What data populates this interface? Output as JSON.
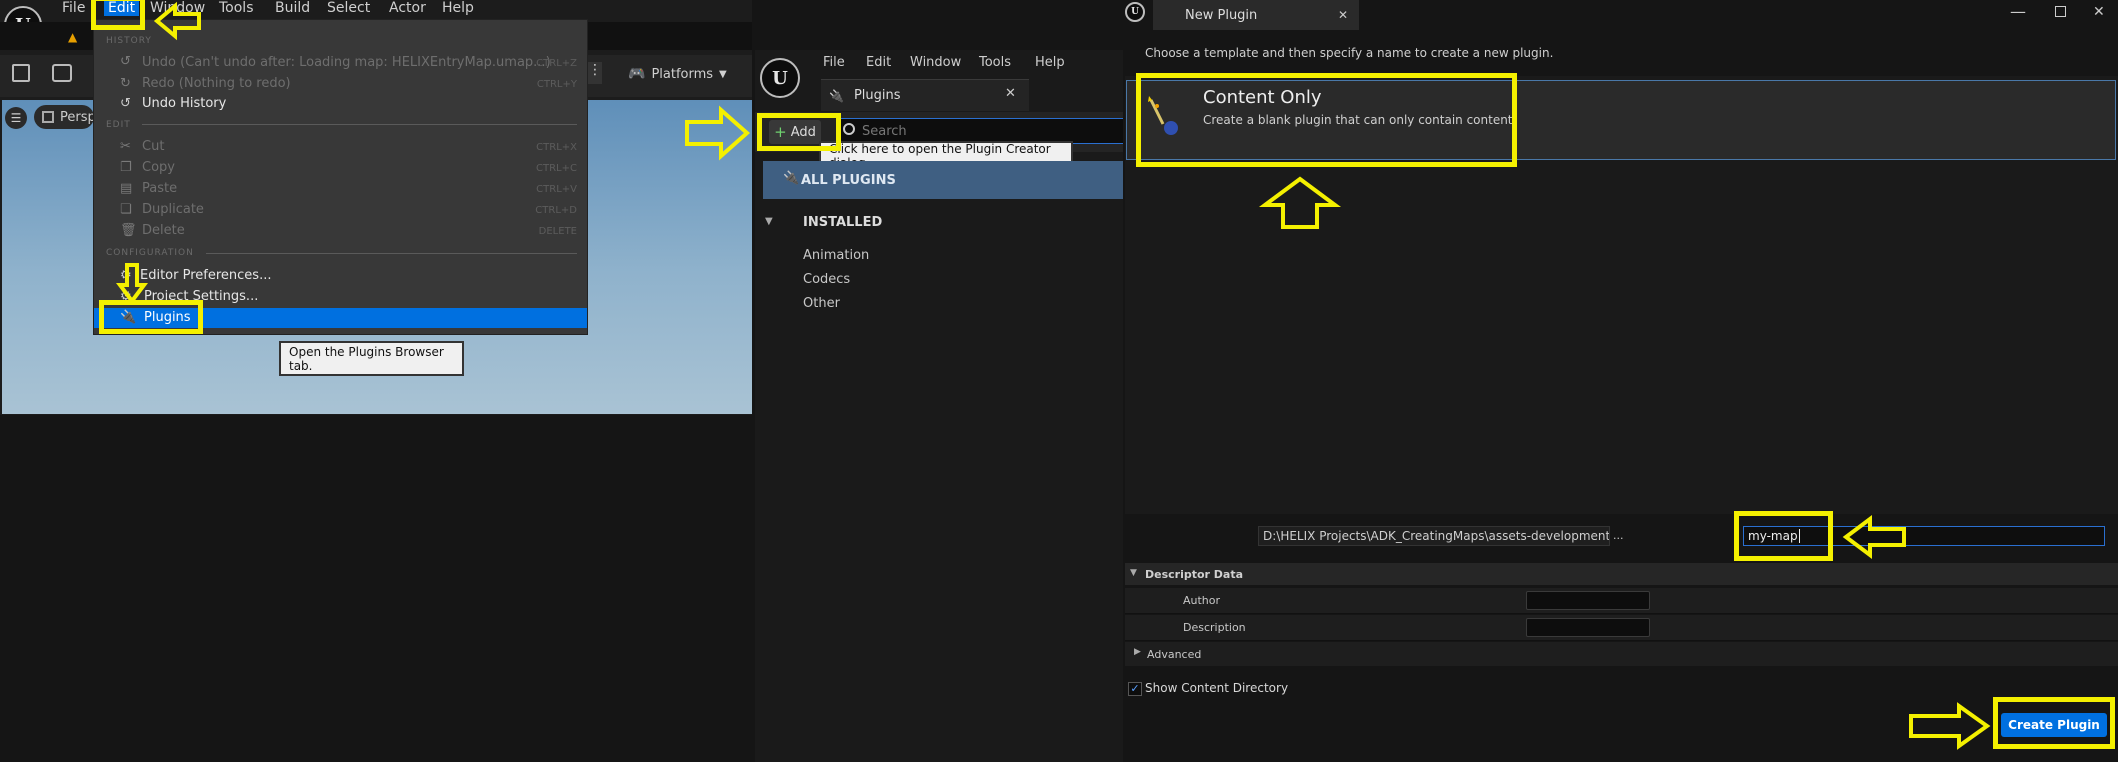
{
  "left": {
    "menu": [
      "File",
      "Edit",
      "Window",
      "Tools",
      "Build",
      "Select",
      "Actor",
      "Help"
    ],
    "platforms_label": "Platforms",
    "viewport_label": "Persp",
    "dropdown": {
      "history_header": "HISTORY",
      "undo": "Undo (Can't undo after: Loading map: HELIXEntryMap.umap...)",
      "undo_sc": "CTRL+Z",
      "redo": "Redo (Nothing to redo)",
      "redo_sc": "CTRL+Y",
      "undo_history": "Undo History",
      "edit_header": "EDIT",
      "cut": "Cut",
      "cut_sc": "CTRL+X",
      "copy": "Copy",
      "copy_sc": "CTRL+C",
      "paste": "Paste",
      "paste_sc": "CTRL+V",
      "duplicate": "Duplicate",
      "duplicate_sc": "CTRL+D",
      "delete": "Delete",
      "delete_sc": "DELETE",
      "config_header": "CONFIGURATION",
      "editor_prefs": "Editor Preferences...",
      "project_settings": "Project Settings...",
      "plugins": "Plugins"
    },
    "tooltip": "Open the Plugins Browser tab."
  },
  "middle": {
    "menu": [
      "File",
      "Edit",
      "Window",
      "Tools",
      "Help"
    ],
    "tab_title": "Plugins",
    "add_label": "Add",
    "search_placeholder": "Search",
    "tooltip": "Click here to open the Plugin Creator dialog.",
    "all_plugins": "ALL PLUGINS",
    "installed": "INSTALLED",
    "categories": [
      "Animation",
      "Codecs",
      "Other"
    ]
  },
  "right": {
    "tab_title": "New Plugin",
    "instruction": "Choose a template and then specify a name to create a new plugin.",
    "template_title": "Content Only",
    "template_desc": "Create a blank plugin that can only contain content.",
    "path_value": "D:\\HELIX Projects\\ADK_CreatingMaps\\assets-development-kit-main\\Plugins",
    "path_btn": "...",
    "name_value": "my-map",
    "descriptor_header": "Descriptor Data",
    "author_label": "Author",
    "description_label": "Description",
    "advanced_label": "Advanced",
    "show_content_dir": "Show Content Directory",
    "create_btn": "Create Plugin"
  },
  "colors": {
    "highlight": "#f4f000",
    "accent": "#0070e0"
  }
}
